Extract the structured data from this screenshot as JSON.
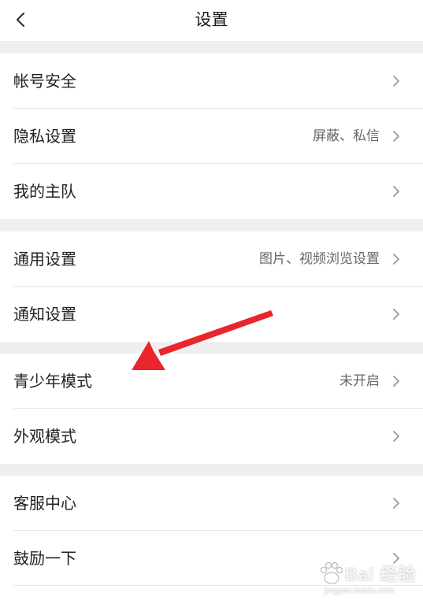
{
  "header": {
    "title": "设置",
    "back_icon": "chevron-left-icon"
  },
  "sections": [
    {
      "rows": [
        {
          "label": "帐号安全",
          "value": ""
        },
        {
          "label": "隐私设置",
          "value": "屏蔽、私信"
        },
        {
          "label": "我的主队",
          "value": ""
        }
      ]
    },
    {
      "rows": [
        {
          "label": "通用设置",
          "value": "图片、视频浏览设置"
        },
        {
          "label": "通知设置",
          "value": ""
        }
      ]
    },
    {
      "rows": [
        {
          "label": "青少年模式",
          "value": "未开启"
        },
        {
          "label": "外观模式",
          "value": ""
        }
      ]
    },
    {
      "rows": [
        {
          "label": "客服中心",
          "value": ""
        },
        {
          "label": "鼓励一下",
          "value": ""
        }
      ]
    }
  ],
  "colors": {
    "background": "#ffffff",
    "divider": "#efeff1",
    "label": "#222222",
    "value": "#666666",
    "chevron": "#999999",
    "annotation_arrow": "#e8262c"
  },
  "annotation": {
    "type": "arrow",
    "points_to": "青少年模式"
  },
  "watermark": {
    "text": "Bai 经验",
    "url": "jingyan.baidu.com"
  }
}
